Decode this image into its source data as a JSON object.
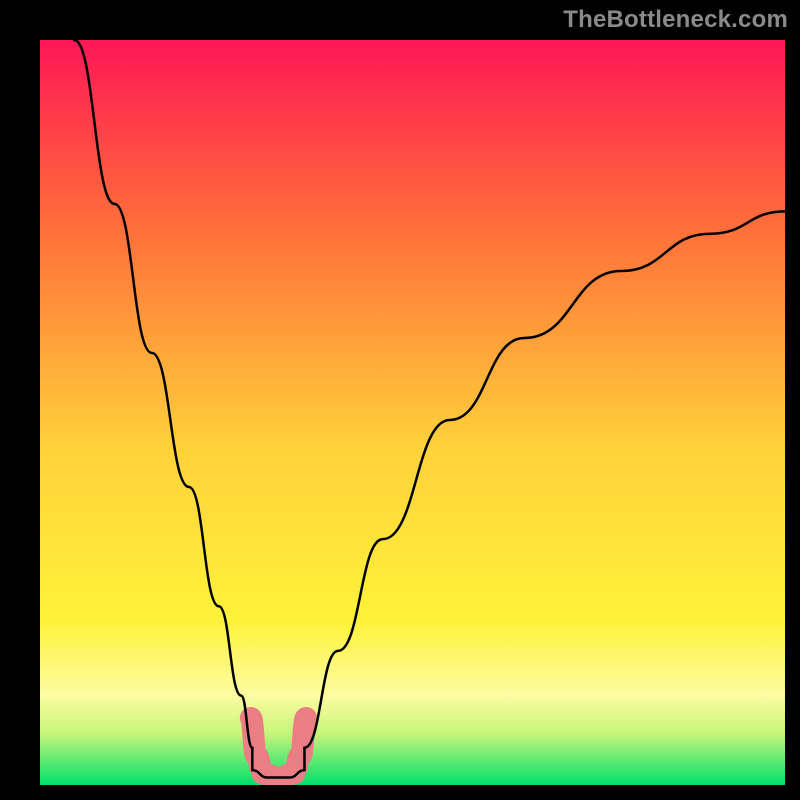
{
  "watermark": "TheBottleneck.com",
  "chart_data": {
    "type": "line",
    "title": "",
    "xlabel": "",
    "ylabel": "",
    "xlim": [
      0,
      1
    ],
    "ylim": [
      0,
      100
    ],
    "background_gradient": {
      "top_color": "#ff1756",
      "mid_color": "#fff23a",
      "green_band_top": "#fdfca2",
      "green_band_bottom": "#00e06a"
    },
    "curve": {
      "description": "V-shaped bottleneck curve",
      "left_branch": [
        {
          "x": 0.046,
          "y": 100
        },
        {
          "x": 0.1,
          "y": 78
        },
        {
          "x": 0.15,
          "y": 58
        },
        {
          "x": 0.2,
          "y": 40
        },
        {
          "x": 0.24,
          "y": 24
        },
        {
          "x": 0.27,
          "y": 12
        },
        {
          "x": 0.285,
          "y": 5
        }
      ],
      "flat_minimum": [
        {
          "x": 0.285,
          "y": 2
        },
        {
          "x": 0.305,
          "y": 1
        },
        {
          "x": 0.335,
          "y": 1
        },
        {
          "x": 0.355,
          "y": 2
        }
      ],
      "right_branch": [
        {
          "x": 0.355,
          "y": 5
        },
        {
          "x": 0.4,
          "y": 18
        },
        {
          "x": 0.46,
          "y": 33
        },
        {
          "x": 0.55,
          "y": 49
        },
        {
          "x": 0.65,
          "y": 60
        },
        {
          "x": 0.78,
          "y": 69
        },
        {
          "x": 0.9,
          "y": 74
        },
        {
          "x": 1.0,
          "y": 77
        }
      ]
    },
    "highlight_pink_region": {
      "color": "#e97e84",
      "points": [
        {
          "x": 0.283,
          "y": 9
        },
        {
          "x": 0.29,
          "y": 4
        },
        {
          "x": 0.3,
          "y": 1.5
        },
        {
          "x": 0.32,
          "y": 1
        },
        {
          "x": 0.34,
          "y": 1.5
        },
        {
          "x": 0.35,
          "y": 4
        },
        {
          "x": 0.357,
          "y": 9
        }
      ]
    }
  }
}
